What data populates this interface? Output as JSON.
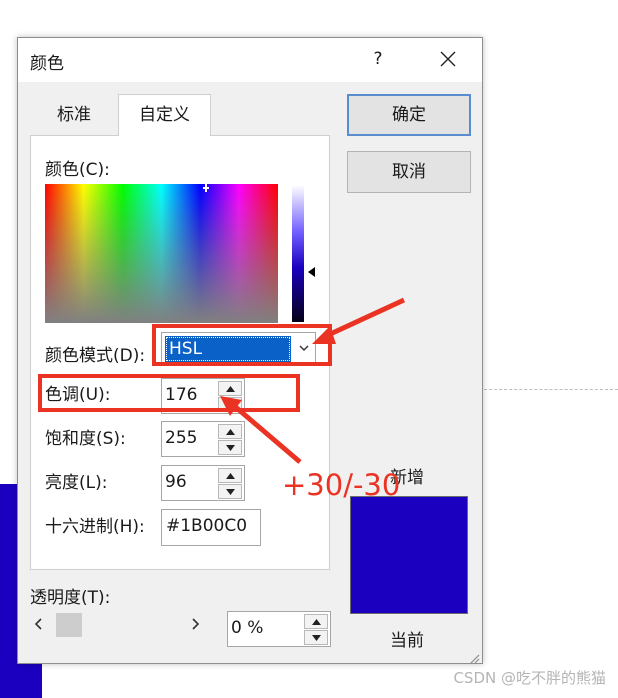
{
  "dialog": {
    "title": "颜色",
    "help_label": "?",
    "tabs": [
      {
        "label": "标准",
        "active": false
      },
      {
        "label": "自定义",
        "active": true
      }
    ],
    "ok_label": "确定",
    "cancel_label": "取消",
    "colors_label": "颜色(C):",
    "color_mode_label": "颜色模式(D):",
    "color_mode_value": "HSL",
    "hue_label": "色调(U):",
    "hue_value": "176",
    "saturation_label": "饱和度(S):",
    "saturation_value": "255",
    "luminance_label": "亮度(L):",
    "luminance_value": "96",
    "hex_label": "十六进制(H):",
    "hex_value": "#1B00C0",
    "new_label": "新增",
    "current_label": "当前",
    "transparency_label": "透明度(T):",
    "transparency_value": "0 %",
    "swatch_color": "#1B00C0"
  },
  "annotation": {
    "text": "+30/-30",
    "color": "#ea3323"
  },
  "watermark": "CSDN @吃不胖的熊猫"
}
